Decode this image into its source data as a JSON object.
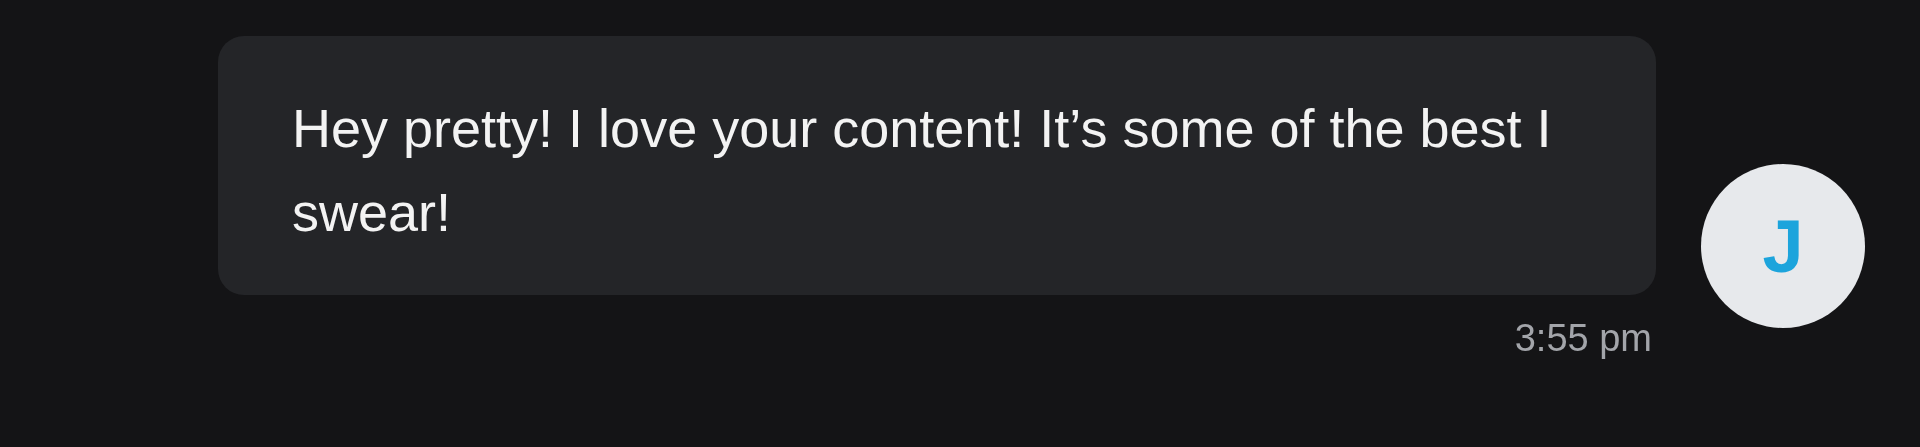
{
  "message": {
    "avatar_initial": "J",
    "text": "Hey pretty! I love your content! It’s some of the best I swear!",
    "time": "3:55 pm"
  }
}
